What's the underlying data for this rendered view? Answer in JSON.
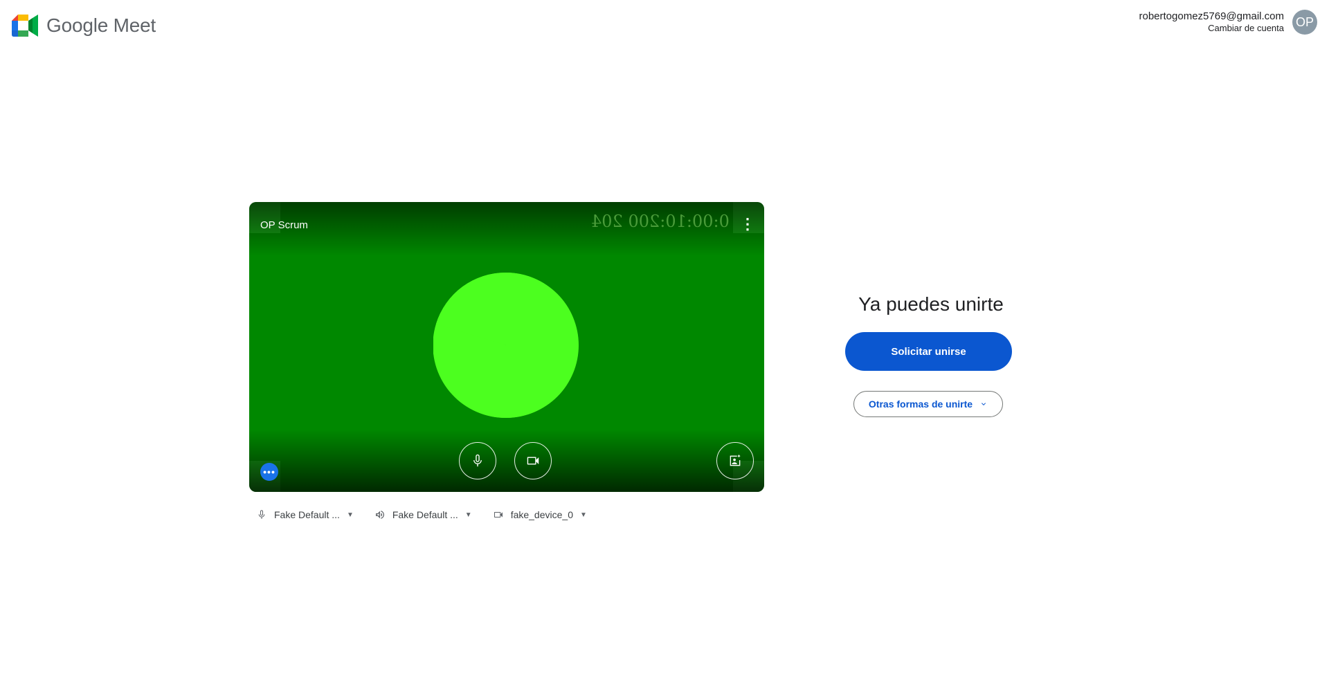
{
  "header": {
    "app_name": "Google Meet",
    "account_email": "robertogomez5769@gmail.com",
    "switch_account": "Cambiar de cuenta",
    "avatar_initials": "OP"
  },
  "preview": {
    "meeting_name": "OP Scrum",
    "timestamp_mirrored": "0:00:10:200 204",
    "more_options_label": "⋮",
    "dots_badge": "•••",
    "background_color": "#008800",
    "pie_color": "#4cff1f"
  },
  "devices": {
    "microphone": "Fake Default ...",
    "speaker": "Fake Default ...",
    "camera": "fake_device_0"
  },
  "join": {
    "title": "Ya puedes unirte",
    "button_label": "Solicitar unirse",
    "other_ways_label": "Otras formas de unirte",
    "accent_color": "#0b57d0"
  }
}
